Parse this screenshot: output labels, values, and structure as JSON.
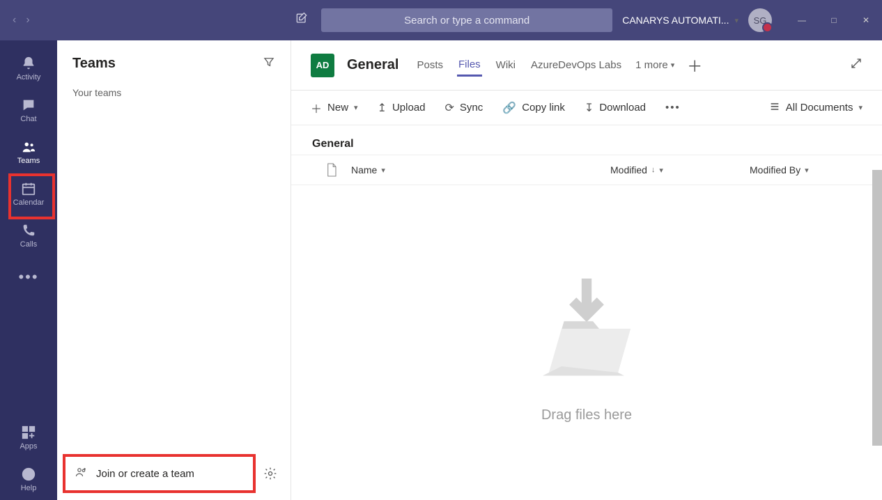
{
  "titlebar": {
    "search_placeholder": "Search or type a command",
    "org_name": "CANARYS AUTOMATI...",
    "avatar_initials": "SG"
  },
  "rail": {
    "items": [
      {
        "label": "Activity"
      },
      {
        "label": "Chat"
      },
      {
        "label": "Teams"
      },
      {
        "label": "Calendar"
      },
      {
        "label": "Calls"
      }
    ],
    "apps": "Apps",
    "help": "Help"
  },
  "sidebar": {
    "title": "Teams",
    "section": "Your teams",
    "join_label": "Join or create a team"
  },
  "header": {
    "badge": "AD",
    "channel": "General",
    "tabs": [
      {
        "label": "Posts"
      },
      {
        "label": "Files"
      },
      {
        "label": "Wiki"
      },
      {
        "label": "AzureDevOps Labs"
      }
    ],
    "more": "1 more"
  },
  "commands": {
    "new": "New",
    "upload": "Upload",
    "sync": "Sync",
    "copylink": "Copy link",
    "download": "Download",
    "view": "All Documents"
  },
  "files": {
    "folder": "General",
    "columns": {
      "name": "Name",
      "modified": "Modified",
      "modified_by": "Modified By"
    },
    "empty_text": "Drag files here"
  }
}
